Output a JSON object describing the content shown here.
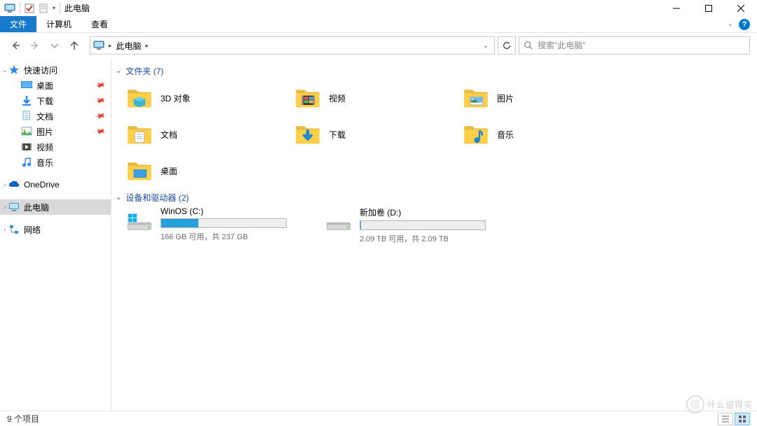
{
  "window": {
    "title": "此电脑",
    "min": "—",
    "max": "☐",
    "close": "✕"
  },
  "ribbon": {
    "tabs": [
      "文件",
      "计算机",
      "查看"
    ]
  },
  "nav": {
    "breadcrumb": "此电脑",
    "search_placeholder": "搜索\"此电脑\""
  },
  "sidebar": {
    "quick_access": "快速访问",
    "items": [
      {
        "label": "桌面"
      },
      {
        "label": "下载"
      },
      {
        "label": "文档"
      },
      {
        "label": "图片"
      },
      {
        "label": "视频"
      },
      {
        "label": "音乐"
      }
    ],
    "onedrive": "OneDrive",
    "this_pc": "此电脑",
    "network": "网络"
  },
  "groups": {
    "folders_header": "文件夹 (7)",
    "folders": [
      {
        "label": "3D 对象",
        "icon": "3d"
      },
      {
        "label": "视频",
        "icon": "video"
      },
      {
        "label": "图片",
        "icon": "pictures"
      },
      {
        "label": "文档",
        "icon": "docs"
      },
      {
        "label": "下载",
        "icon": "downloads"
      },
      {
        "label": "音乐",
        "icon": "music"
      },
      {
        "label": "桌面",
        "icon": "desktop"
      }
    ],
    "drives_header": "设备和驱动器 (2)",
    "drives": [
      {
        "name": "WinOS (C:)",
        "stats": "166 GB 可用，共 237 GB",
        "fill_pct": 30,
        "os": true
      },
      {
        "name": "新加卷 (D:)",
        "stats": "2.09 TB 可用，共 2.09 TB",
        "fill_pct": 0,
        "os": false
      }
    ]
  },
  "statusbar": {
    "count": "9 个项目"
  },
  "watermark": "什么值得买"
}
